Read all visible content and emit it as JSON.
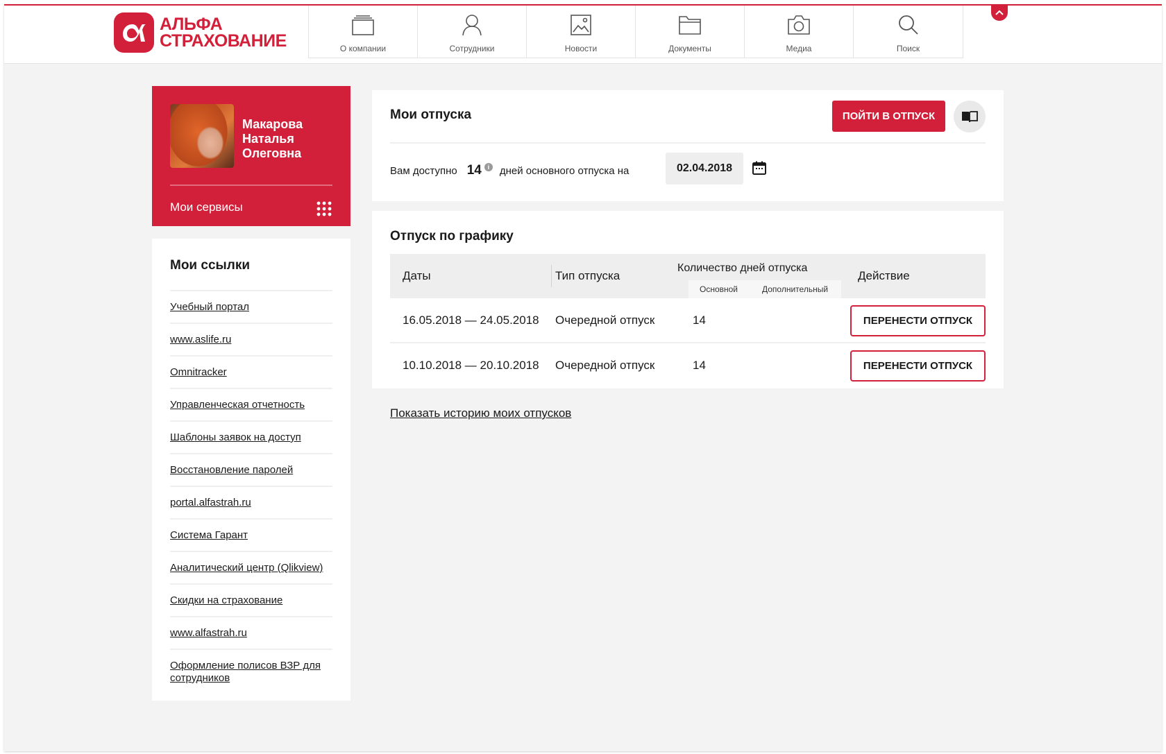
{
  "brand": {
    "name_line1": "АЛЬФА",
    "name_line2": "СТРАХОВАНИЕ",
    "color": "#d3203a"
  },
  "nav": {
    "items": [
      {
        "label": "О компании",
        "icon": "layers-icon"
      },
      {
        "label": "Сотрудники",
        "icon": "person-icon"
      },
      {
        "label": "Новости",
        "icon": "image-icon"
      },
      {
        "label": "Документы",
        "icon": "folder-icon"
      },
      {
        "label": "Медиа",
        "icon": "camera-icon"
      },
      {
        "label": "Поиск",
        "icon": "search-icon"
      }
    ]
  },
  "profile": {
    "name_line1": "Макарова",
    "name_line2": "Наталья",
    "name_line3": "Олеговна",
    "services_label": "Мои сервисы"
  },
  "links": {
    "title": "Мои ссылки",
    "items": [
      "Учебный портал",
      "www.aslife.ru",
      "Omnitracker",
      "Управленческая отчетность",
      "Шаблоны заявок на доступ",
      "Восстановление паролей",
      "portal.alfastrah.ru",
      "Система Гарант",
      "Аналитический центр (Qlikview)",
      "Скидки на страхование",
      "www.alfastrah.ru",
      "Оформление полисов ВЗР для сотрудников"
    ]
  },
  "vacations": {
    "title": "Мои отпуска",
    "go_button": "ПОЙТИ В ОТПУСК",
    "available_prefix": "Вам доступно",
    "available_days": "14",
    "available_suffix": "дней основного отпуска на",
    "date": "02.04.2018"
  },
  "schedule": {
    "title": "Отпуск по графику",
    "headers": {
      "dates": "Даты",
      "type": "Тип отпуска",
      "days": "Количество дней отпуска",
      "days_main": "Основной",
      "days_extra": "Дополнительный",
      "action": "Действие"
    },
    "rows": [
      {
        "dates": "16.05.2018 — 24.05.2018",
        "type": "Очередной отпуск",
        "main": "14",
        "extra": "",
        "action": "ПЕРЕНЕСТИ ОТПУСК"
      },
      {
        "dates": "10.10.2018 — 20.10.2018",
        "type": "Очередной отпуск",
        "main": "14",
        "extra": "",
        "action": "ПЕРЕНЕСТИ ОТПУСК"
      }
    ]
  },
  "history_link": "Показать историю моих отпусков"
}
